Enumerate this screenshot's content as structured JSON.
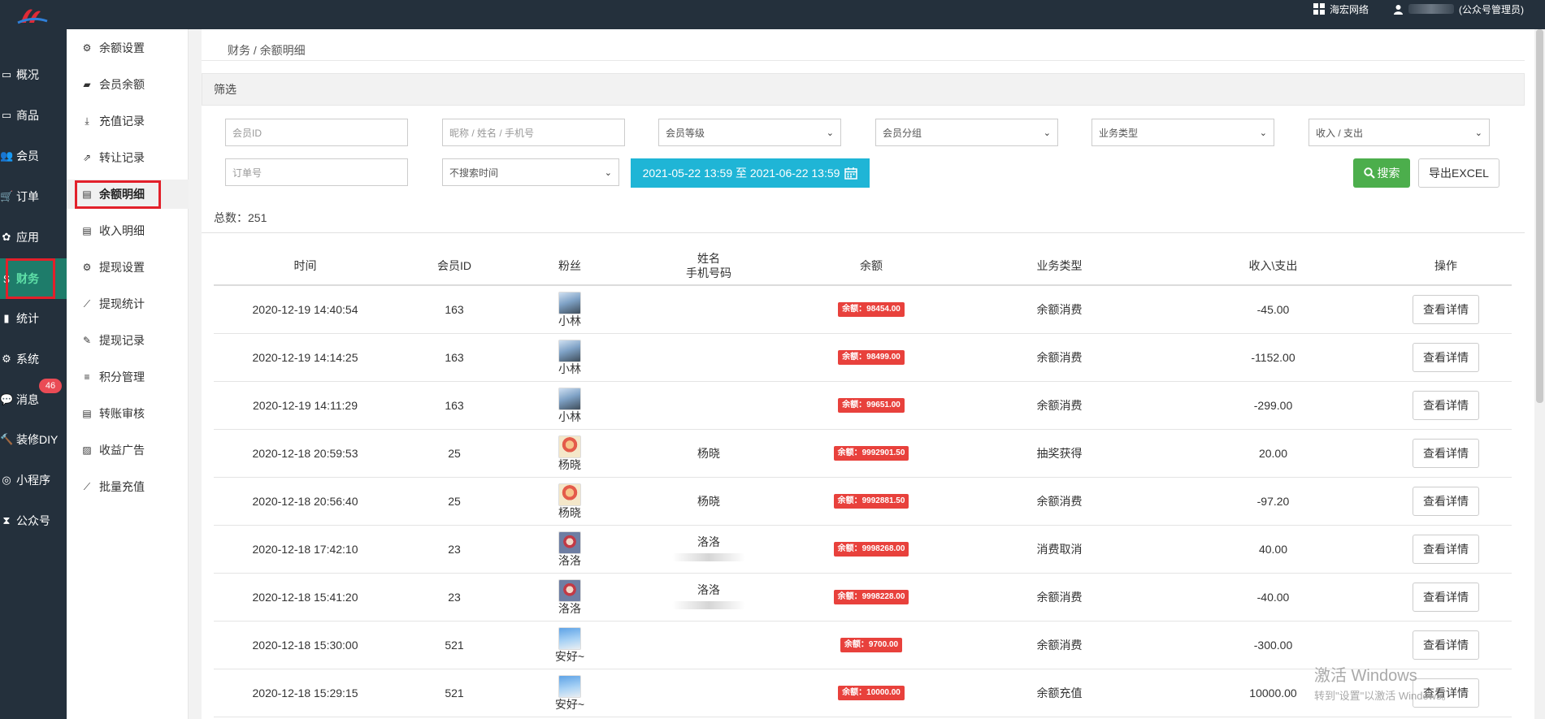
{
  "topbar": {
    "brand_link": "海宏网络",
    "user_suffix": "(公众号管理员)"
  },
  "nav1": [
    {
      "label": "概况",
      "icon": "monitor-icon",
      "glyph": "▭"
    },
    {
      "label": "商品",
      "icon": "goods-icon",
      "glyph": "▭"
    },
    {
      "label": "会员",
      "icon": "users-icon",
      "glyph": "👥"
    },
    {
      "label": "订单",
      "icon": "cart-icon",
      "glyph": "🛒"
    },
    {
      "label": "应用",
      "icon": "apps-icon",
      "glyph": "✿"
    },
    {
      "label": "财务",
      "icon": "finance-icon",
      "glyph": "$"
    },
    {
      "label": "统计",
      "icon": "bar-chart-icon",
      "glyph": "▮"
    },
    {
      "label": "系统",
      "icon": "gear-icon",
      "glyph": "⚙"
    },
    {
      "label": "消息",
      "icon": "chat-icon",
      "glyph": "💬"
    },
    {
      "label": "装修DIY",
      "icon": "hammer-icon",
      "glyph": "🔨"
    },
    {
      "label": "小程序",
      "icon": "wechat-icon",
      "glyph": "◎"
    },
    {
      "label": "公众号",
      "icon": "hourglass-icon",
      "glyph": "⧗"
    }
  ],
  "message_badge": "46",
  "nav2": [
    {
      "label": "余额设置",
      "icon": "gear-icon",
      "glyph": "⚙"
    },
    {
      "label": "会员余额",
      "icon": "book-icon",
      "glyph": "▰"
    },
    {
      "label": "充值记录",
      "icon": "download-icon",
      "glyph": "⤓"
    },
    {
      "label": "转让记录",
      "icon": "external-link-icon",
      "glyph": "⇗"
    },
    {
      "label": "余额明细",
      "icon": "document-icon",
      "glyph": "▤"
    },
    {
      "label": "收入明细",
      "icon": "document-icon",
      "glyph": "▤"
    },
    {
      "label": "提现设置",
      "icon": "gear-icon",
      "glyph": "⚙"
    },
    {
      "label": "提现统计",
      "icon": "line-chart-icon",
      "glyph": "⟋"
    },
    {
      "label": "提现记录",
      "icon": "pencil-icon",
      "glyph": "✎"
    },
    {
      "label": "积分管理",
      "icon": "database-icon",
      "glyph": "≡"
    },
    {
      "label": "转账审核",
      "icon": "document-icon",
      "glyph": "▤"
    },
    {
      "label": "收益广告",
      "icon": "image-icon",
      "glyph": "▨"
    },
    {
      "label": "批量充值",
      "icon": "line-chart-icon",
      "glyph": "⟋"
    }
  ],
  "breadcrumb": "财务 / 余额明细",
  "filter": {
    "title": "筛选",
    "member_id_placeholder": "会员ID",
    "keyword_placeholder": "昵称 / 姓名 / 手机号",
    "member_level": "会员等级",
    "member_group": "会员分组",
    "business_type": "业务类型",
    "in_out": "收入 / 支出",
    "order_no_placeholder": "订单号",
    "time_mode": "不搜索时间",
    "date_range": "2021-05-22 13:59 至 2021-06-22 13:59",
    "search_label": "搜索",
    "export_label": "导出EXCEL"
  },
  "total": "总数：251",
  "table": {
    "headers": {
      "time": "时间",
      "member_id": "会员ID",
      "fan": "粉丝",
      "name": "姓名",
      "phone": "手机号码",
      "balance": "余额",
      "biz_type": "业务类型",
      "in_out": "收入\\支出",
      "action": "操作"
    },
    "detail_label": "查看详情",
    "rows": [
      {
        "time": "2020-12-19 14:40:54",
        "member_id": "163",
        "fan": "小林",
        "name": "",
        "balance": "余额：98454.00",
        "type": "余额消费",
        "amount": "-45.00"
      },
      {
        "time": "2020-12-19 14:14:25",
        "member_id": "163",
        "fan": "小林",
        "name": "",
        "balance": "余额：98499.00",
        "type": "余额消费",
        "amount": "-1152.00"
      },
      {
        "time": "2020-12-19 14:11:29",
        "member_id": "163",
        "fan": "小林",
        "name": "",
        "balance": "余额：99651.00",
        "type": "余额消费",
        "amount": "-299.00"
      },
      {
        "time": "2020-12-18 20:59:53",
        "member_id": "25",
        "fan": "杨晓",
        "name": "杨晓",
        "balance": "余额：9992901.50",
        "type": "抽奖获得",
        "amount": "20.00"
      },
      {
        "time": "2020-12-18 20:56:40",
        "member_id": "25",
        "fan": "杨晓",
        "name": "杨晓",
        "balance": "余额：9992881.50",
        "type": "余额消费",
        "amount": "-97.20"
      },
      {
        "time": "2020-12-18 17:42:10",
        "member_id": "23",
        "fan": "洛洛",
        "name": "洛洛",
        "balance": "余额：9998268.00",
        "type": "消费取消",
        "amount": "40.00"
      },
      {
        "time": "2020-12-18 15:41:20",
        "member_id": "23",
        "fan": "洛洛",
        "name": "洛洛",
        "balance": "余额：9998228.00",
        "type": "余额消费",
        "amount": "-40.00"
      },
      {
        "time": "2020-12-18 15:30:00",
        "member_id": "521",
        "fan": "安好~",
        "name": "",
        "balance": "余额：9700.00",
        "type": "余额消费",
        "amount": "-300.00"
      },
      {
        "time": "2020-12-18 15:29:15",
        "member_id": "521",
        "fan": "安好~",
        "name": "",
        "balance": "余额：10000.00",
        "type": "余额充值",
        "amount": "10000.00"
      }
    ]
  },
  "watermark": {
    "line1": "激活 Windows",
    "line2": "转到\"设置\"以激活 Windows。"
  }
}
